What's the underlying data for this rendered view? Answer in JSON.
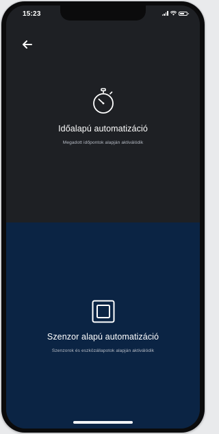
{
  "status_bar": {
    "time": "15:23"
  },
  "options": [
    {
      "title": "Időalapú automatizáció",
      "subtitle": "Megadott időpontok alapján aktiválódik",
      "icon": "stopwatch-icon"
    },
    {
      "title": "Szenzor alapú automatizáció",
      "subtitle": "Szenzorok és eszközállapotok alapján aktiválódik",
      "icon": "sensor-square-icon"
    }
  ],
  "colors": {
    "top_panel": "#1e2024",
    "bottom_panel": "#0b2444",
    "text_primary": "#ffffff",
    "text_secondary": "#b7bcc6"
  }
}
